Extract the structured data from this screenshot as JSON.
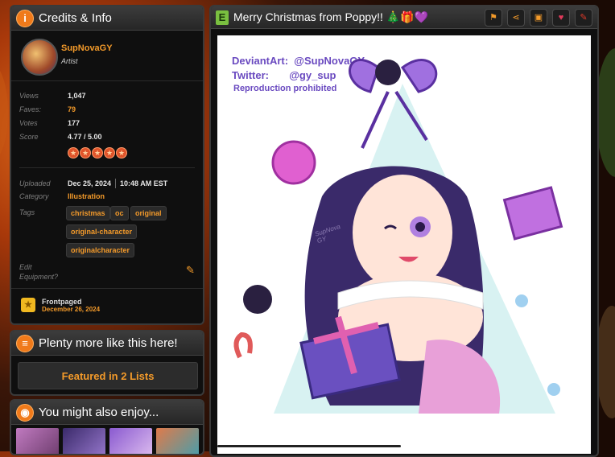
{
  "credits": {
    "title": "Credits & Info",
    "artist_name": "SupNovaGY",
    "artist_role": "Artist",
    "stats": [
      {
        "label": "Views",
        "value": "1,047"
      },
      {
        "label": "Faves:",
        "value": "79"
      },
      {
        "label": "Votes",
        "value": "177"
      },
      {
        "label": "Score",
        "value": "4.77 / 5.00"
      }
    ],
    "stars": 5,
    "uploaded_label": "Uploaded",
    "uploaded_date": "Dec 25, 2024",
    "uploaded_time": "10:48 AM EST",
    "category_label": "Category",
    "category_value": "Illustration",
    "tags_label": "Tags",
    "tags": [
      "christmas",
      "oc",
      "original",
      "original-character",
      "originalcharacter"
    ],
    "edit_label": "Edit Equipment?",
    "frontpaged_label": "Frontpaged",
    "frontpaged_date": "December 26, 2024"
  },
  "more": {
    "title": "Plenty more like this here!",
    "featured_button": "Featured in 2 Lists"
  },
  "enjoy": {
    "title": "You might also enjoy..."
  },
  "art": {
    "title": "Merry Christmas from Poppy!! 🎄🎁💜",
    "credit_line1": "DeviantArt:  @SupNovaGY",
    "credit_line2": "Twitter:       @gy_sup",
    "credit_line3": "Reproduction prohibited",
    "signature": "SupNova GY"
  },
  "colors": {
    "accent": "#f39a2a",
    "panel": "#0f0f0f",
    "header": "#2e2e2e"
  }
}
